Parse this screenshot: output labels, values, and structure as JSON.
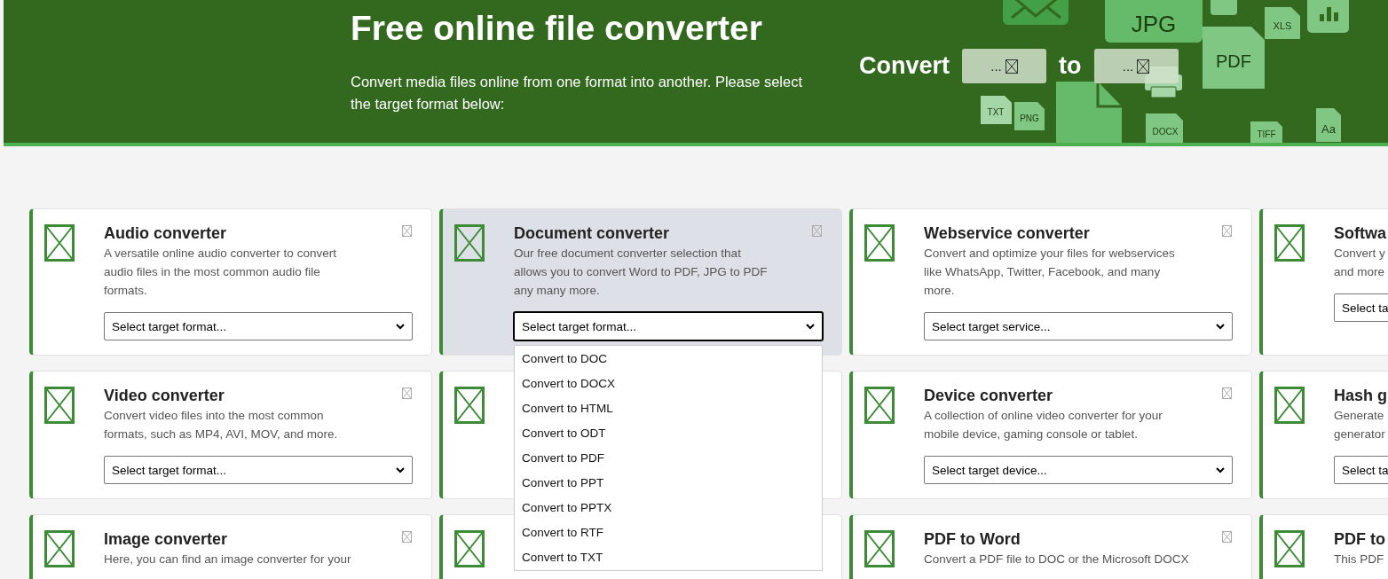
{
  "header": {
    "title": "Free online file converter",
    "subtitle": "Convert media files online from one format into another. Please select the target format below:",
    "convert_label": "Convert",
    "from_field": {
      "value": "..."
    },
    "to_label": "to",
    "to_field": {
      "value": "..."
    },
    "illustration_labels": [
      "JPG",
      "XLS",
      "PDF",
      "TXT",
      "PNG",
      "DOCX",
      "TIFF",
      "Aa"
    ]
  },
  "cards": [
    {
      "title": "Audio converter",
      "description": [
        "A versatile online audio converter to convert",
        "audio files in the most common audio file",
        "formats."
      ],
      "select": {
        "placeholder": "Select target format...",
        "expanded": false
      },
      "selected": false
    },
    {
      "title": "Document converter",
      "description": [
        "Our free document converter selection that",
        "allows you to convert Word to PDF, JPG to PDF",
        "any many more."
      ],
      "select": {
        "placeholder": "Select target format...",
        "expanded": true,
        "options": [
          "Convert to DOC",
          "Convert to DOCX",
          "Convert to HTML",
          "Convert to ODT",
          "Convert to PDF",
          "Convert to PPT",
          "Convert to PPTX",
          "Convert to RTF",
          "Convert to TXT"
        ]
      },
      "selected": true
    },
    {
      "title": "Webservice converter",
      "description": [
        "Convert and optimize your files for webservices",
        "like WhatsApp, Twitter, Facebook, and many",
        "more."
      ],
      "select": {
        "placeholder": "Select target service...",
        "expanded": false
      },
      "selected": false
    },
    {
      "title": "Softwa",
      "description": [
        "Convert y",
        "and more"
      ],
      "select": {
        "placeholder": "Select ta",
        "expanded": false
      },
      "selected": false
    },
    {
      "title": "Video converter",
      "description": [
        "Convert video files into the most common",
        "formats, such as MP4, AVI, MOV, and more."
      ],
      "select": {
        "placeholder": "Select target format...",
        "expanded": false
      },
      "selected": false
    },
    {
      "selected": false
    },
    {
      "title": "Device converter",
      "description": [
        "A collection of online video converter for your",
        "mobile device, gaming console or tablet."
      ],
      "select": {
        "placeholder": "Select target device...",
        "expanded": false
      },
      "selected": false
    },
    {
      "title": "Hash g",
      "description": [
        "Generate",
        "generator"
      ],
      "select": {
        "placeholder": "Select ta",
        "expanded": false
      },
      "selected": false
    },
    {
      "title": "Image converter",
      "description": [
        "Here, you can find an image converter for your"
      ],
      "selected": false
    },
    {
      "selected": false
    },
    {
      "title": "PDF to Word",
      "description": [
        "Convert a PDF file to DOC or the Microsoft DOCX"
      ],
      "selected": false
    },
    {
      "title": "PDF to",
      "description": [
        "This PDF"
      ],
      "selected": false
    }
  ]
}
